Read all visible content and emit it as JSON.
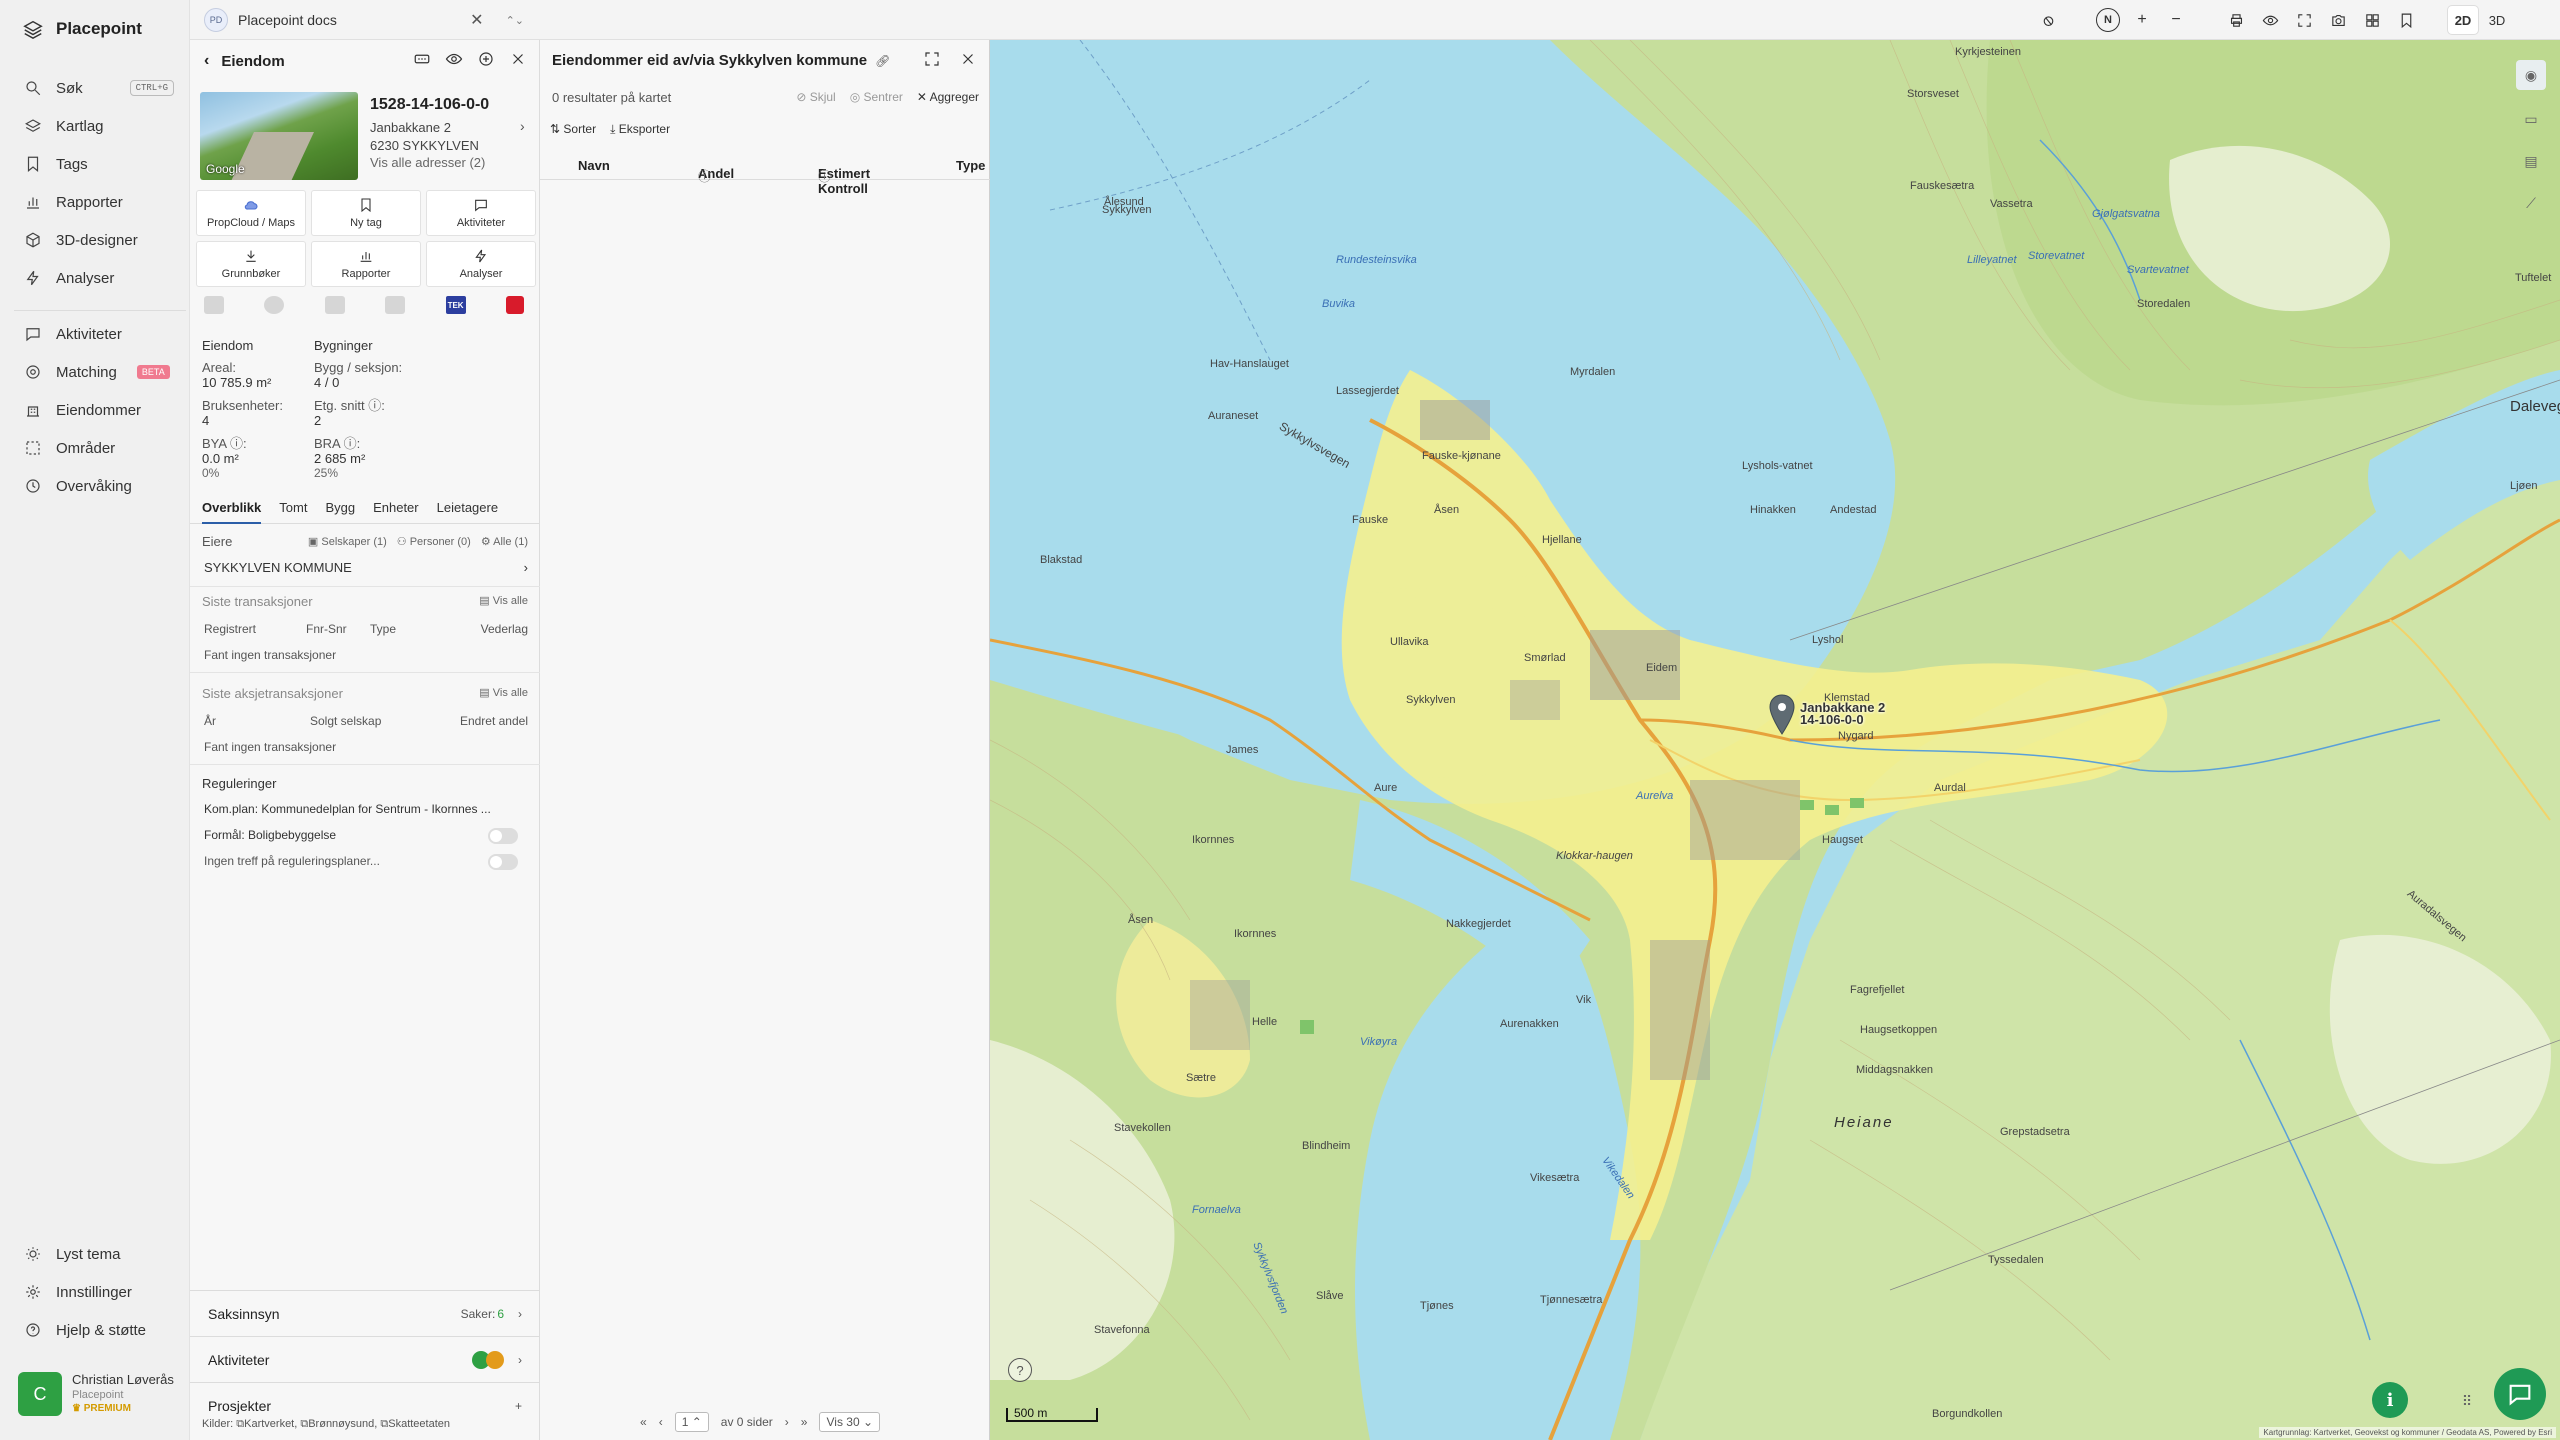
{
  "nav": {
    "brand": "Placepoint",
    "items": [
      {
        "label": "Søk",
        "shortcut": "CTRL+G"
      },
      {
        "label": "Kartlag"
      },
      {
        "label": "Tags"
      },
      {
        "label": "Rapporter"
      },
      {
        "label": "3D-designer"
      },
      {
        "label": "Analyser"
      },
      {
        "label": "Aktiviteter"
      },
      {
        "label": "Matching",
        "badge": "BETA"
      },
      {
        "label": "Eiendommer"
      },
      {
        "label": "Områder"
      },
      {
        "label": "Overvåking"
      }
    ],
    "bottom": [
      {
        "label": "Lyst tema"
      },
      {
        "label": "Innstillinger"
      },
      {
        "label": "Hjelp & støtte"
      }
    ],
    "user": {
      "initial": "C",
      "name": "Christian Løverås",
      "company": "Placepoint",
      "plan": "PREMIUM"
    }
  },
  "topbar": {
    "docs_badge": "PD",
    "docs_label": "Placepoint docs",
    "compass": "N",
    "view_2d": "2D",
    "view_3d": "3D"
  },
  "property": {
    "header": "Eiendom",
    "matrikkel": "1528-14-106-0-0",
    "address_line1": "Janbakkane 2",
    "address_line2": "6230 SYKKYLVEN",
    "all_addresses": "Vis alle adresser (2)",
    "photo_credit": "Google",
    "actions": [
      "PropCloud / Maps",
      "Ny tag",
      "Aktiviteter",
      "Grunnbøker",
      "Rapporter",
      "Analyser"
    ],
    "tek_label": "TEK",
    "stats": {
      "col1_title": "Eiendom",
      "col2_title": "Bygninger",
      "areal_label": "Areal:",
      "areal_value": "10 785.9 m²",
      "bygg_label": "Bygg / seksjon:",
      "bygg_value": "4 / 0",
      "bruks_label": "Bruksenheter:",
      "bruks_value": "4",
      "etg_label": "Etg. snitt ⓘ:",
      "etg_value": "2",
      "bya_label": "BYA ⓘ:",
      "bya_value": "0.0 m²",
      "bya_pct": "0%",
      "bra_label": "BRA ⓘ:",
      "bra_value": "2 685 m²",
      "bra_pct": "25%"
    },
    "tabs": [
      "Overblikk",
      "Tomt",
      "Bygg",
      "Enheter",
      "Leietagere"
    ],
    "owners": {
      "label": "Eiere",
      "companies": "Selskaper (1)",
      "persons": "Personer (0)",
      "all": "Alle (1)",
      "owner_name": "SYKKYLVEN KOMMUNE"
    },
    "transactions": {
      "title": "Siste transaksjoner",
      "show_all": "Vis alle",
      "cols": [
        "Registrert",
        "Fnr-Snr",
        "Type",
        "Vederlag"
      ],
      "empty": "Fant ingen transaksjoner"
    },
    "share_transactions": {
      "title": "Siste aksjetransaksjoner",
      "show_all": "Vis alle",
      "cols": [
        "År",
        "Solgt selskap",
        "Endret andel"
      ],
      "empty": "Fant ingen transaksjoner"
    },
    "regulations": {
      "title": "Reguleringer",
      "plan": "Kom.plan: Kommunedelplan for Sentrum - Ikornnes ...",
      "purpose": "Formål: Boligbebyggelse",
      "none": "Ingen treff på reguleringsplaner..."
    },
    "accordions": {
      "cases_label": "Saksinnsyn",
      "cases_count_label": "Saker:",
      "cases_count": "6",
      "activities_label": "Aktiviteter",
      "projects_label": "Prosjekter"
    },
    "sources": {
      "label": "Kilder:",
      "items": [
        "Kartverket,",
        "Brønnøysund,",
        "Skatteetaten"
      ]
    }
  },
  "results": {
    "title": "Eiendommer eid av/via Sykkylven kommune",
    "count": "0 resultater på kartet",
    "hide": "Skjul",
    "center": "Sentrer",
    "aggregate": "Aggreger",
    "sort": "Sorter",
    "export": "Eksporter",
    "columns": [
      "Navn",
      "Andel",
      "Estimert Kontroll",
      "Type"
    ],
    "pager": {
      "page": "1",
      "of_pages": "av 0 sider",
      "per_page": "Vis 30"
    }
  },
  "map": {
    "pin_label_line1": "Janbakkane 2",
    "pin_label_line2": "14-106-0-0",
    "scale": "500 m",
    "attribution": "Kartgrunnlag: Kartverket, Geovekst og kommuner / Geodata AS, Powered by Esri",
    "places": [
      {
        "name": "Kyrkjesteinen",
        "kind": "land"
      },
      {
        "name": "Storsveset",
        "kind": "land"
      },
      {
        "name": "Ålesund",
        "kind": "land"
      },
      {
        "name": "Sykkylven",
        "kind": "land"
      },
      {
        "name": "Fauskesætra",
        "kind": "land"
      },
      {
        "name": "Vassetra",
        "kind": "land"
      },
      {
        "name": "Gjølgatsvatna",
        "kind": "water"
      },
      {
        "name": "Lilleyatnet",
        "kind": "water"
      },
      {
        "name": "Svartevatnet",
        "kind": "water"
      },
      {
        "name": "Storevatnet",
        "kind": "water"
      },
      {
        "name": "Storedalen",
        "kind": "land"
      },
      {
        "name": "Tuftelet",
        "kind": "land"
      },
      {
        "name": "Dalevegen",
        "kind": "land"
      },
      {
        "name": "Rundesteinsvika",
        "kind": "water"
      },
      {
        "name": "Buvika",
        "kind": "water"
      },
      {
        "name": "Myrdalen",
        "kind": "land"
      },
      {
        "name": "Hav-Hanslauget",
        "kind": "land"
      },
      {
        "name": "Lassegjerdet",
        "kind": "land"
      },
      {
        "name": "Auraneset",
        "kind": "land"
      },
      {
        "name": "Sykkylvsvegen",
        "kind": "land"
      },
      {
        "name": "Fauske",
        "kind": "land"
      },
      {
        "name": "Fauske-kjønane",
        "kind": "land"
      },
      {
        "name": "Åsen",
        "kind": "land"
      },
      {
        "name": "Hjellane",
        "kind": "land"
      },
      {
        "name": "Lyshols-vatnet",
        "kind": "land"
      },
      {
        "name": "Hinakken",
        "kind": "land"
      },
      {
        "name": "Andestad",
        "kind": "land"
      },
      {
        "name": "Blakstad",
        "kind": "land"
      },
      {
        "name": "Ullavika",
        "kind": "land"
      },
      {
        "name": "Smørlad",
        "kind": "land"
      },
      {
        "name": "Eidem",
        "kind": "land"
      },
      {
        "name": "Lyshol",
        "kind": "land"
      },
      {
        "name": "Sykkylven",
        "kind": "land"
      },
      {
        "name": "Klemstad",
        "kind": "land"
      },
      {
        "name": "Nygard",
        "kind": "land"
      },
      {
        "name": "Aurdal",
        "kind": "land"
      },
      {
        "name": "James",
        "kind": "land"
      },
      {
        "name": "Aure",
        "kind": "land"
      },
      {
        "name": "Aurelva",
        "kind": "water"
      },
      {
        "name": "Haugset",
        "kind": "land"
      },
      {
        "name": "Klokkar-haugen",
        "kind": "land"
      },
      {
        "name": "Ikornnes",
        "kind": "land"
      },
      {
        "name": "Nakkegjerdet",
        "kind": "land"
      },
      {
        "name": "Åsen",
        "kind": "land"
      },
      {
        "name": "Ikornnes",
        "kind": "land"
      },
      {
        "name": "Fagrefjellet",
        "kind": "land"
      },
      {
        "name": "Vik",
        "kind": "land"
      },
      {
        "name": "Aurenakken",
        "kind": "land"
      },
      {
        "name": "Haugsetkoppen",
        "kind": "land"
      },
      {
        "name": "Helle",
        "kind": "land"
      },
      {
        "name": "Vikøyra",
        "kind": "water"
      },
      {
        "name": "Middagsnakken",
        "kind": "land"
      },
      {
        "name": "Sætre",
        "kind": "land"
      },
      {
        "name": "Heiane",
        "kind": "water"
      },
      {
        "name": "Stavekollen",
        "kind": "land"
      },
      {
        "name": "Blindheim",
        "kind": "land"
      },
      {
        "name": "Grepstadsetra",
        "kind": "land"
      },
      {
        "name": "Vikesætra",
        "kind": "land"
      },
      {
        "name": "Vikedalen",
        "kind": "water"
      },
      {
        "name": "Fornaelva",
        "kind": "water"
      },
      {
        "name": "Sykkylvsfjorden",
        "kind": "water"
      },
      {
        "name": "Tyssedalen",
        "kind": "land"
      },
      {
        "name": "Slåve",
        "kind": "land"
      },
      {
        "name": "Tjønnesætra",
        "kind": "land"
      },
      {
        "name": "Tjønes",
        "kind": "land"
      },
      {
        "name": "Stavefonna",
        "kind": "land"
      },
      {
        "name": "Borgundkollen",
        "kind": "land"
      },
      {
        "name": "Auradalsvegen",
        "kind": "land"
      },
      {
        "name": "Ljøen",
        "kind": "land"
      }
    ]
  }
}
